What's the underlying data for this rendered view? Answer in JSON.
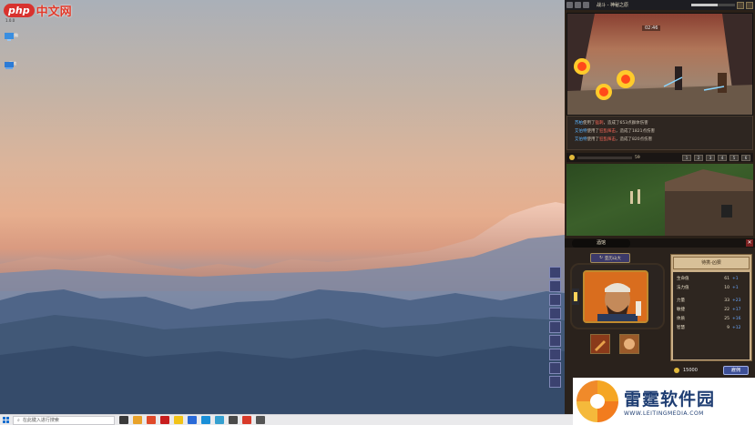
{
  "desktop": {
    "logo_badge": "php",
    "logo_text": "中文网",
    "logo_sub": "1.0.0",
    "icons": [
      {
        "name": "network-computer-icon",
        "label": "此电脑"
      },
      {
        "name": "computer-icon",
        "label": "网络"
      }
    ]
  },
  "taskbar": {
    "search_placeholder": "在此键入进行搜索",
    "apps": [
      "#3a3a3a",
      "#e8a22a",
      "#e04a2a",
      "#c81e1e",
      "#f2c318",
      "#2a6ad8",
      "#1a8fd8",
      "#35a0d0",
      "#4a4a4a",
      "#d83a2a",
      "#555555"
    ]
  },
  "game": {
    "title": "战斗 - 神秘之原",
    "timer": "02:46",
    "log": [
      {
        "actor": "苏柏",
        "verb": "使用了",
        "skill": "猛刺",
        "result": "，造成了653点群体伤害"
      },
      {
        "actor": "艾伯特",
        "verb": "使用了",
        "skill": "狂乱挥击",
        "result": "，造成了1821点伤害"
      },
      {
        "actor": "艾伯特",
        "verb": "使用了",
        "skill": "狂乱挥击",
        "result": "，造成了820点伤害"
      }
    ],
    "toolbar_value": "59",
    "toolbar_buttons": [
      "1",
      "2",
      "3",
      "4",
      "5",
      "6"
    ],
    "panel": {
      "tab": "酒馆",
      "close": "✕",
      "hero_name": "亚历山大",
      "stats_title": "待携-凶狠",
      "stats": [
        {
          "k": "生命值",
          "v": "61",
          "b": "+1"
        },
        {
          "k": "法力值",
          "v": "10",
          "b": "+1"
        }
      ],
      "attrs": [
        {
          "k": "力量",
          "v": "33",
          "b": "+23"
        },
        {
          "k": "敏捷",
          "v": "22",
          "b": "+17"
        },
        {
          "k": "体质",
          "v": "25",
          "b": "+16"
        },
        {
          "k": "智慧",
          "v": "9",
          "b": "+12"
        }
      ],
      "gold": "15000",
      "hire": "雇佣"
    }
  },
  "watermark": {
    "title": "雷霆软件园",
    "url": "WWW.LEITINGMEDIA.COM"
  }
}
